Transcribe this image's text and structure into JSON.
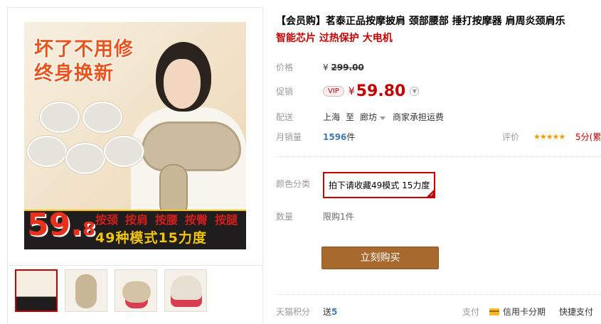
{
  "product": {
    "title": "【会员购】茗泰正品按摩披肩 颈部腰部 捶打按摩器 肩周炎颈肩乐",
    "subtitle": "智能芯片 过热保护 大电机"
  },
  "main_image": {
    "headline_line1": "坏了不用修",
    "headline_line2": "终身换新",
    "price_int": "59.",
    "price_dec": "8",
    "tags": [
      "按颈",
      "按肩",
      "按腰",
      "按臀",
      "按腿"
    ],
    "subline": "49种模式15力度"
  },
  "thumbnails": [
    {
      "name": "thumbnail-1",
      "active": true
    },
    {
      "name": "thumbnail-2",
      "active": false
    },
    {
      "name": "thumbnail-3",
      "active": false
    },
    {
      "name": "thumbnail-4",
      "active": false
    }
  ],
  "price": {
    "label": "价格",
    "currency": "¥",
    "original": "299.00"
  },
  "promo": {
    "label": "促销",
    "badge": "VIP",
    "currency": "¥",
    "value": "59.80"
  },
  "shipping": {
    "label": "配送",
    "from": "上海",
    "to_word": "至",
    "dest": "廊坊",
    "fee": "商家承担运费"
  },
  "sales": {
    "label": "月销量",
    "count": "1596",
    "unit": "件",
    "rating_label": "评价",
    "stars": "★★★★★",
    "rating_value": "5分(累"
  },
  "color": {
    "label": "颜色分类",
    "selected": "拍下请收藏49模式 15力度"
  },
  "quantity": {
    "label": "数量",
    "limit": "限购1件"
  },
  "buy_button": "立刻购买",
  "bottom": {
    "points_label": "天猫积分",
    "points_prefix": "送",
    "points_value": "5",
    "pay_label": "支付",
    "credit": "信用卡分期",
    "express": "快捷支付"
  },
  "colors": {
    "accent_red": "#c40000",
    "buy_button_bg": "#a8692f",
    "link_blue": "#3c7ab1",
    "star_orange": "#f39c00"
  }
}
